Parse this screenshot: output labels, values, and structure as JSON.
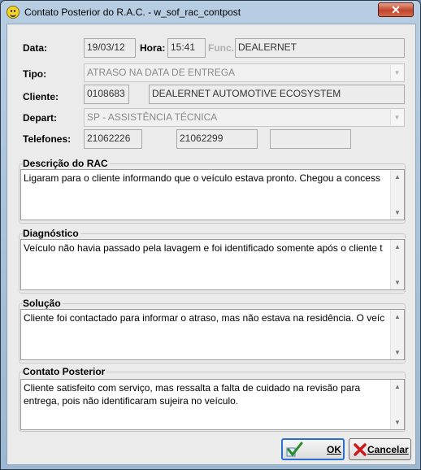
{
  "window": {
    "title": "Contato Posterior do R.A.C. - w_sof_rac_contpost",
    "close_symbol": "✕"
  },
  "header": {
    "data_label": "Data:",
    "data_value": "19/03/12",
    "hora_label": "Hora:",
    "hora_value": "15:41",
    "func_label": "Func.:",
    "func_value": "DEALERNET",
    "tipo_label": "Tipo:",
    "tipo_value": "ATRASO NA DATA DE ENTREGA",
    "cliente_label": "Cliente:",
    "cliente_code": "0108683",
    "cliente_name": "DEALERNET AUTOMOTIVE ECOSYSTEM",
    "depart_label": "Depart:",
    "depart_value": "SP - ASSISTÊNCIA TÉCNICA",
    "telefones_label": "Telefones:",
    "telefone1": "21062226",
    "telefone2": "21062299",
    "telefone3": ""
  },
  "sections": {
    "descricao": {
      "title": "Descrição do RAC",
      "text": "Ligaram para o cliente informando que o veículo estava pronto. Chegou a concess"
    },
    "diagnostico": {
      "title": "Diagnóstico",
      "text": "Veículo não havia passado pela lavagem e foi identificado somente após o cliente t"
    },
    "solucao": {
      "title": "Solução",
      "text": "Cliente foi contactado para informar o atraso, mas não estava na residência. O veíc"
    },
    "contato": {
      "title": "Contato Posterior",
      "text": "Cliente satisfeito com serviço, mas ressalta a falta de cuidado na revisão para entrega, pois não identificaram sujeira no veículo."
    }
  },
  "buttons": {
    "ok_label": "OK",
    "cancel_label": "Cancelar"
  },
  "icons": {
    "window": "smiley-icon",
    "ok": "checkmark-icon",
    "cancel": "x-icon"
  },
  "colors": {
    "ok_icon": "#2a8a2a",
    "cancel_icon": "#cc1a1a",
    "close_button": "#c0442c"
  }
}
